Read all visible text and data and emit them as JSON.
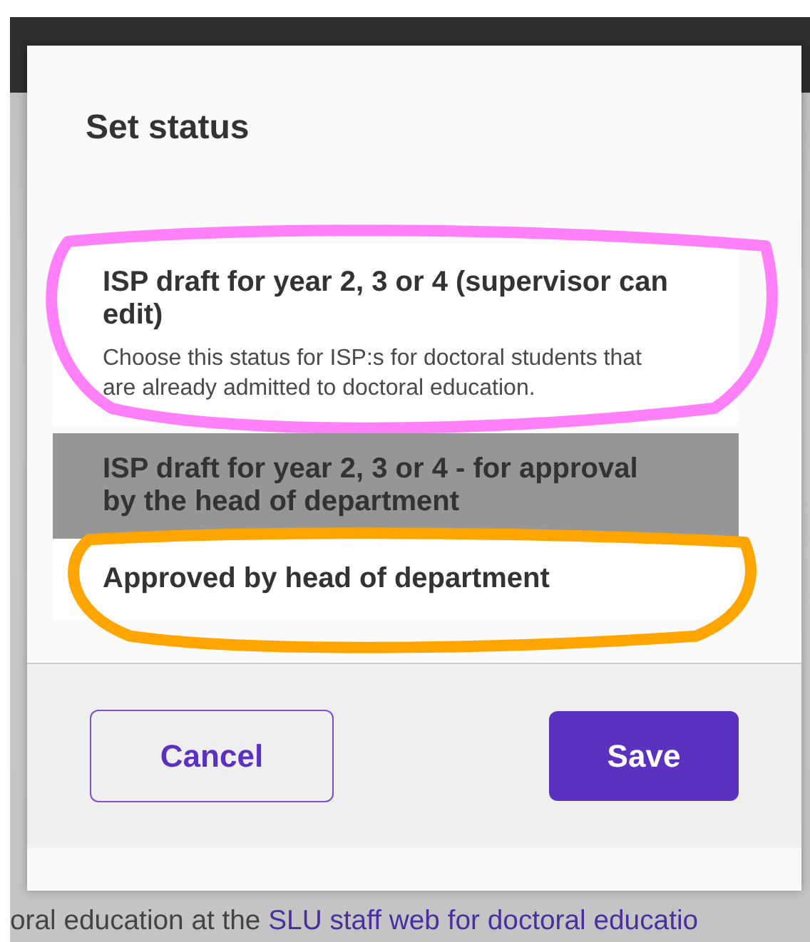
{
  "page": {
    "footer_text": "oral education at the ",
    "footer_link": "SLU staff web for doctoral educatio"
  },
  "dialog": {
    "title": "Set status",
    "options": [
      {
        "title": "ISP draft for year 2, 3 or 4 (supervisor can edit)",
        "description": "Choose this status for ISP:s for doctoral students that are already admitted to doctoral education.",
        "selected": false,
        "annotation": {
          "kind": "loop",
          "color": "#ff80f8"
        }
      },
      {
        "title": "ISP draft for year 2, 3 or 4 - for approval by the head of department",
        "selected": true
      },
      {
        "title": "Approved by head of department",
        "selected": false,
        "annotation": {
          "kind": "loop",
          "color": "#ffa500"
        }
      }
    ],
    "buttons": [
      {
        "label": "Cancel",
        "kind": "secondary"
      },
      {
        "label": "Save",
        "kind": "primary"
      }
    ]
  }
}
